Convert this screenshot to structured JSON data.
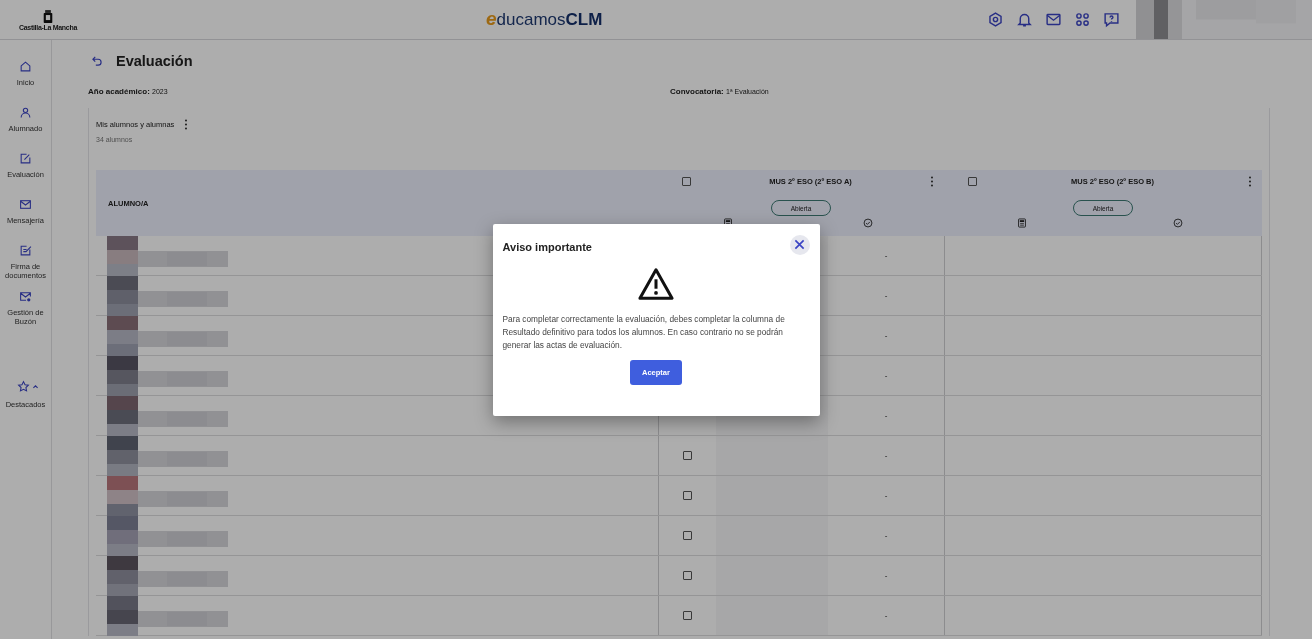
{
  "header": {
    "region_logo": "Castilla-La Mancha",
    "app_logo": {
      "accent": "e",
      "main": "ducamos",
      "strong": "CLM"
    }
  },
  "sidebar": {
    "items": [
      {
        "label": "Inicio",
        "selected": false
      },
      {
        "label": "Alumnado",
        "selected": false
      },
      {
        "label": "Evaluación",
        "selected": false
      },
      {
        "label": "Mensajería",
        "selected": false
      },
      {
        "label": "Firma de documentos",
        "selected": false
      },
      {
        "label": "Gestión de Buzón",
        "selected": false
      }
    ],
    "favorites": {
      "label": "Destacados",
      "expanded": true
    }
  },
  "page": {
    "title": "Evaluación",
    "fields": [
      {
        "label": "Año académico:",
        "value": "2023"
      },
      {
        "label": "Convocatoria:",
        "value": "1ª Evaluación"
      }
    ],
    "card": {
      "title": "Mis alumnos y alumnas",
      "count": "34 alumnos"
    },
    "table": {
      "first_column": "ALUMNO/A",
      "groups": [
        {
          "title": "MUS 2º ESO (2º ESO A)",
          "status": "Abierta",
          "checked": false
        },
        {
          "title": "MUS 2º ESO (2º ESO B)",
          "status": "Abierta",
          "checked": false
        }
      ],
      "rows": [
        {
          "kind": "picture",
          "result": "-"
        },
        {
          "kind": "picture",
          "result": "-"
        },
        {
          "kind": "picture",
          "result": "-"
        },
        {
          "kind": "picture",
          "result": "-"
        },
        {
          "kind": "picture",
          "result": "-"
        },
        {
          "kind": "picture",
          "checked": false,
          "result": "-"
        },
        {
          "kind": "picture",
          "checked": false,
          "result": "-"
        },
        {
          "kind": "picture",
          "checked": false,
          "result": "-"
        },
        {
          "kind": "picture",
          "checked": false,
          "result": "-"
        },
        {
          "kind": "picture",
          "checked": false,
          "result": "-"
        }
      ]
    }
  },
  "dialog": {
    "title": "Aviso importante",
    "message": "Para completar correctamente la evaluación, debes completar la columna de Resultado definitivo para todos los alumnos. En caso contrario no se podrán generar las actas de evaluación.",
    "button": "Aceptar"
  }
}
